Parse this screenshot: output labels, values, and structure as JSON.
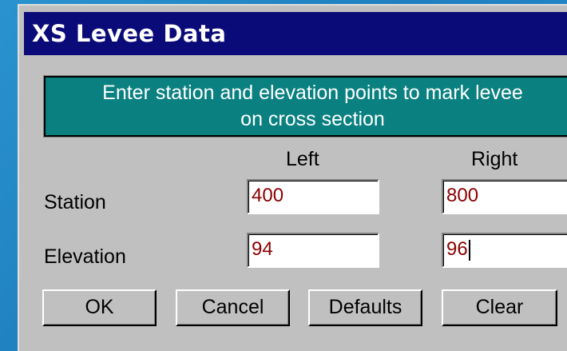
{
  "window": {
    "title": "XS Levee Data"
  },
  "banner": {
    "text_line1": "Enter station and elevation points to mark levee",
    "text_line2": "on cross section"
  },
  "columns": {
    "left": "Left",
    "right": "Right"
  },
  "rows": {
    "station": {
      "label": "Station",
      "left": "400",
      "right": "800"
    },
    "elevation": {
      "label": "Elevation",
      "left": "94",
      "right": "96"
    }
  },
  "buttons": {
    "ok": "OK",
    "cancel": "Cancel",
    "defaults": "Defaults",
    "clear": "Clear"
  },
  "colors": {
    "titlebar": "#0a0a78",
    "banner": "#0b8080",
    "dialog": "#c0c0c0",
    "field_text": "#8b0000",
    "desktop": "#1f7fbf"
  }
}
